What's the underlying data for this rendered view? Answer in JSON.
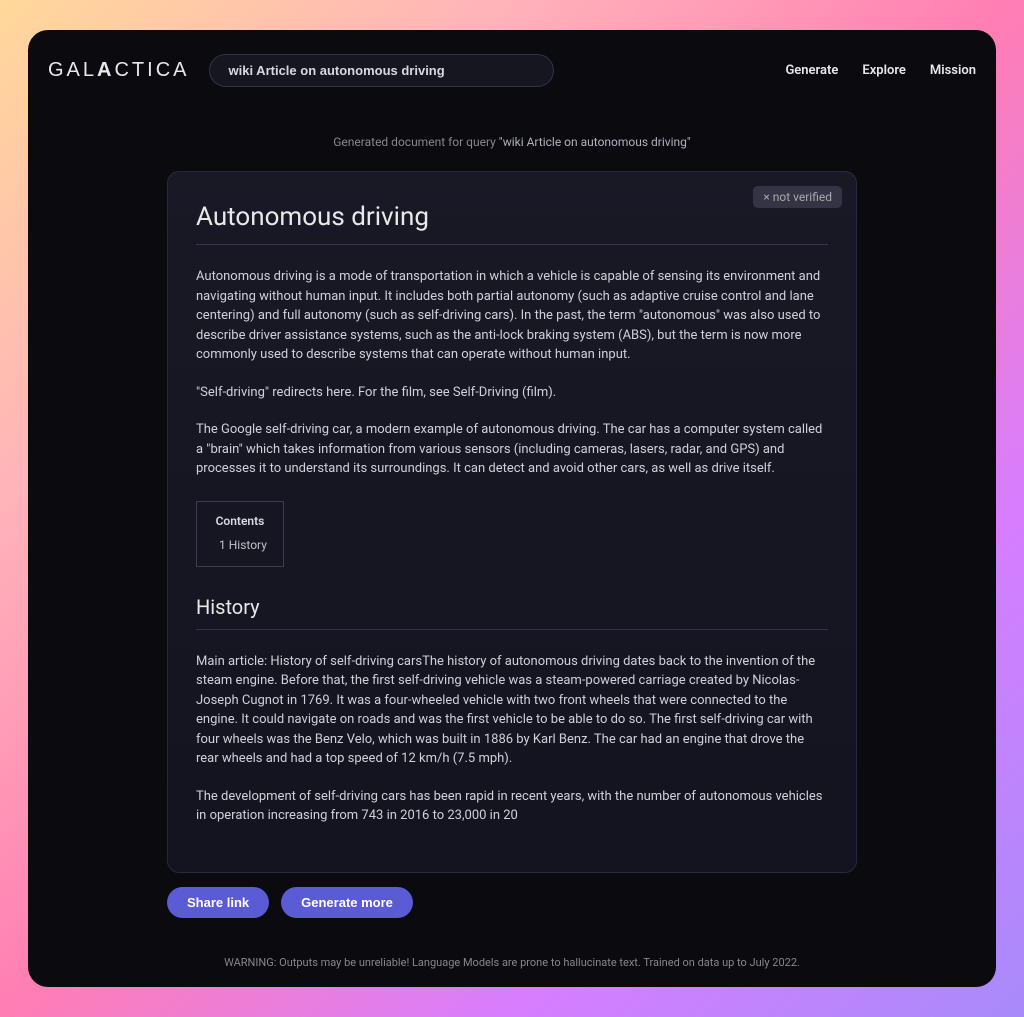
{
  "header": {
    "logo_prefix": "GAL",
    "logo_bold": "A",
    "logo_suffix": "CTICA",
    "search_value": "wiki Article on autonomous driving",
    "nav": {
      "generate": "Generate",
      "explore": "Explore",
      "mission": "Mission"
    }
  },
  "query": {
    "prefix": "Generated document for query ",
    "text": "\"wiki Article on autonomous driving\""
  },
  "badge": {
    "label": "× not verified"
  },
  "article": {
    "title": "Autonomous driving",
    "p1": "Autonomous driving is a mode of transportation in which a vehicle is capable of sensing its environment and navigating without human input. It includes both partial autonomy (such as adaptive cruise control and lane centering) and full autonomy (such as self-driving cars). In the past, the term \"autonomous\" was also used to describe driver assistance systems, such as the anti-lock braking system (ABS), but the term is now more commonly used to describe systems that can operate without human input.",
    "p2": "\"Self-driving\" redirects here. For the film, see Self-Driving (film).",
    "p3": "The Google self-driving car, a modern example of autonomous driving. The car has a computer system called a \"brain\" which takes information from various sensors (including cameras, lasers, radar, and GPS) and processes it to understand its surroundings. It can detect and avoid other cars, as well as drive itself.",
    "contents_title": "Contents",
    "contents_item_1": "1 History",
    "section1_title": "History",
    "p4": "Main article: History of self-driving carsThe history of autonomous driving dates back to the invention of the steam engine. Before that, the first self-driving vehicle was a steam-powered carriage created by Nicolas-Joseph Cugnot in 1769. It was a four-wheeled vehicle with two front wheels that were connected to the engine. It could navigate on roads and was the first vehicle to be able to do so. The first self-driving car with four wheels was the Benz Velo, which was built in 1886 by Karl Benz. The car had an engine that drove the rear wheels and had a top speed of 12 km/h (7.5 mph).",
    "p5": "The development of self-driving cars has been rapid in recent years, with the number of autonomous vehicles in operation increasing from 743 in 2016 to 23,000 in 20"
  },
  "actions": {
    "share": "Share link",
    "generate_more": "Generate more"
  },
  "warning": "WARNING: Outputs may be unreliable! Language Models are prone to hallucinate text. Trained on data up to July 2022."
}
